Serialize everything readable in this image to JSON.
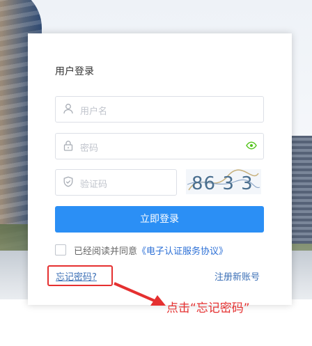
{
  "login": {
    "title": "用户登录",
    "username_placeholder": "用户名",
    "password_placeholder": "密码",
    "captcha_placeholder": "验证码",
    "captcha_code": "86 3 3",
    "login_button": "立即登录",
    "agree_text": "已经阅读并同意",
    "agreement_link": "《电子认证服务协议》",
    "forgot_password": "忘记密码?",
    "register": "注册新账号"
  },
  "annotation": {
    "instruction": "点击“忘记密码”",
    "color": "#e53030"
  },
  "icons": {
    "username": "user-icon",
    "password": "lock-icon",
    "captcha": "shield-icon",
    "show_password": "eye-icon"
  },
  "colors": {
    "primary": "#2b8ff5",
    "link": "#3b6fb6",
    "eye": "#52c41a"
  }
}
